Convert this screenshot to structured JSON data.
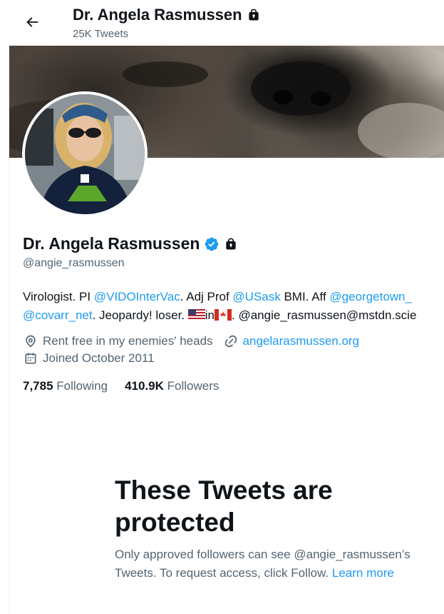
{
  "header": {
    "name": "Dr. Angela Rasmussen",
    "tweet_count": "25K Tweets"
  },
  "profile": {
    "name": "Dr. Angela Rasmussen",
    "handle": "@angie_rasmussen",
    "bio": {
      "line1": {
        "t1": "Virologist. PI ",
        "l1": "@VIDOInterVac",
        "t2": ". Adj Prof ",
        "l2": "@USask",
        "t3": " BMI. Aff ",
        "l3": "@georgetown_"
      },
      "line2": {
        "l1": "@covarr_net",
        "t1": ". Jeopardy! loser. ",
        "t2": "in",
        "t3": ". @angie_rasmussen@mstdn.scie"
      }
    },
    "location": "Rent free in my enemies' heads",
    "website": "angelarasmussen.org",
    "joined": "Joined October 2011",
    "following_count": "7,785",
    "following_label": "Following",
    "followers_count": "410.9K",
    "followers_label": "Followers"
  },
  "protected": {
    "title": "These Tweets are protected",
    "body": "Only approved followers can see @angie_rasmussen’s Tweets. To request access, click Follow.",
    "learn_more": "Learn more"
  },
  "icons": {
    "back": "arrow-left-icon",
    "lock": "lock-icon",
    "verified": "verified-badge-icon",
    "location": "location-pin-icon",
    "link": "link-icon",
    "calendar": "calendar-icon"
  },
  "colors": {
    "accent": "#1d9bf0",
    "text": "#0f1419",
    "secondary": "#536471"
  }
}
